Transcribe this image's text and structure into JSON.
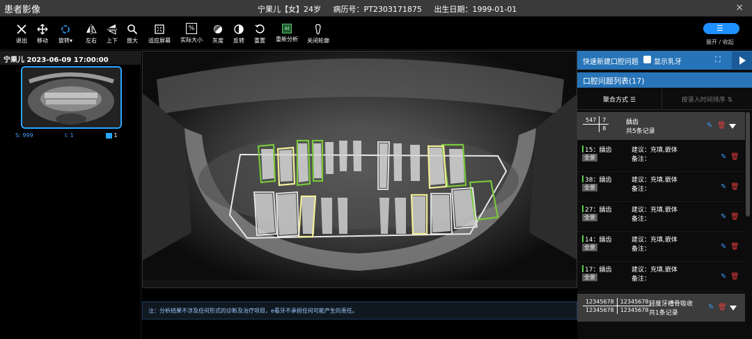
{
  "app_title": "患者影像",
  "patient": {
    "name_gender_age": "宁果儿【女】24岁",
    "record": "病历号：PT2303171875",
    "birthday": "出生日期：1999-01-01"
  },
  "close_glyph": "×",
  "toolbar": {
    "items": [
      {
        "label": "退出",
        "icon": "close-x-icon"
      },
      {
        "label": "移动",
        "icon": "move-arrows-icon"
      },
      {
        "label": "旋转",
        "icon": "rotate-icon"
      },
      {
        "label": "左右",
        "icon": "flip-horizontal-icon"
      },
      {
        "label": "上下",
        "icon": "flip-vertical-icon"
      },
      {
        "label": "放大",
        "icon": "zoom-icon"
      },
      {
        "label": "适应屏幕",
        "icon": "fit-screen-icon"
      },
      {
        "label": "实际大小",
        "icon": "actual-size-icon"
      },
      {
        "label": "灰度",
        "icon": "grayscale-icon"
      },
      {
        "label": "反转",
        "icon": "invert-icon"
      },
      {
        "label": "重置",
        "icon": "reset-icon"
      },
      {
        "label": "重新分析",
        "icon": "ai-reanalyze-icon"
      },
      {
        "label": "关闭轮廓",
        "icon": "contour-icon"
      }
    ],
    "rotate_dropdown": "▾",
    "actual_size_glyph": "%",
    "ai_glyph": "AI",
    "expand_label": "展开 / 收起"
  },
  "left_panel": {
    "header": "宁果儿 2023-06-09 17:00:00",
    "stats": {
      "s": "S: 999",
      "i": "I: 1",
      "series_count": "1"
    }
  },
  "notice": "注：分析结果不涉及任何形式的诊断及治疗项目，e看牙不承担任何可能产生的责任。",
  "right_panel": {
    "quick_add": "快速新建口腔问题",
    "show_milk_teeth": "显示乳牙",
    "list_title": "口腔问题列表(17)",
    "aggregate_label": "聚合方式",
    "sort_label": "按录入时间排序",
    "groups": [
      {
        "codes": [
          [
            "547",
            "7"
          ],
          [
            "",
            "8"
          ]
        ],
        "title": "龋齿",
        "count": "共5条记录"
      },
      {
        "codes": [
          [
            "12345678",
            "12345678"
          ],
          [
            "12345678",
            "12345678"
          ]
        ],
        "title": "轻度牙槽骨吸收",
        "count": "共1条记录"
      }
    ],
    "items": [
      {
        "name": "15：龋齿",
        "tag": "全景",
        "suggest": "建议：充填,嵌体",
        "note": "备注："
      },
      {
        "name": "38：龋齿",
        "tag": "全景",
        "suggest": "建议：充填,嵌体",
        "note": "备注："
      },
      {
        "name": "27：龋齿",
        "tag": "全景",
        "suggest": "建议：充填,嵌体",
        "note": "备注："
      },
      {
        "name": "14：龋齿",
        "tag": "全景",
        "suggest": "建议：充填,嵌体",
        "note": "备注："
      },
      {
        "name": "17：龋齿",
        "tag": "全景",
        "suggest": "建议：充填,嵌体",
        "note": "备注："
      }
    ]
  },
  "colors": {
    "accent_blue": "#2774b8",
    "toggle_blue": "#1e90ff",
    "contour_green": "#79c83a",
    "contour_yellow": "#f4ef9a",
    "contour_white": "#e8e8e8",
    "delete_red": "#e03c3c"
  }
}
